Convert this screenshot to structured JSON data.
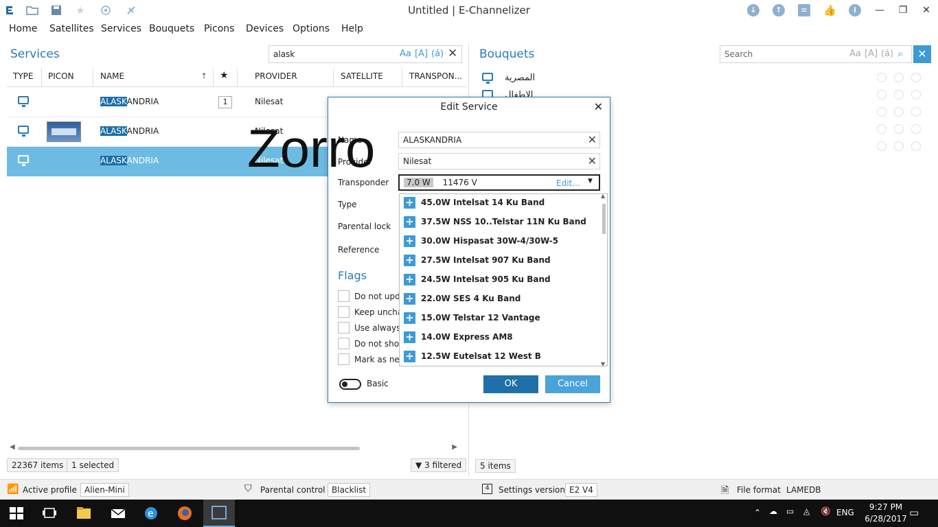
{
  "window": {
    "title": "Untitled | E-Channelizer"
  },
  "menu": [
    "Home",
    "Satellites",
    "Services",
    "Bouquets",
    "Picons",
    "Devices",
    "Options",
    "Help"
  ],
  "services": {
    "title": "Services",
    "search_value": "alask",
    "search_options": {
      "case": "Aa",
      "word": "[A]",
      "accent": "(á)"
    },
    "columns": {
      "type": "TYPE",
      "picon": "PICON",
      "name": "NAME",
      "fav_icon": "star-icon",
      "provider": "PROVIDER",
      "satellite": "SATELLITE",
      "transponder": "TRANSPON..."
    },
    "rows": [
      {
        "name_match": "ALASK",
        "name_rest": "ANDRIA",
        "badge": "1",
        "provider": "Nilesat",
        "has_picon": false,
        "selected": false
      },
      {
        "name_match": "ALASK",
        "name_rest": "ANDRIA",
        "badge": "",
        "provider": "Nilesat",
        "has_picon": true,
        "selected": false
      },
      {
        "name_match": "ALASK",
        "name_rest": "ANDRIA",
        "badge": "",
        "provider": "Nilesat",
        "has_picon": false,
        "selected": true
      }
    ],
    "status": {
      "items": "22367 items",
      "selected": "1 selected",
      "filtered": "3 filtered"
    }
  },
  "watermark": "Zorro",
  "dialog": {
    "title": "Edit Service",
    "labels": {
      "name": "Name",
      "provider": "Provider",
      "transponder": "Transponder",
      "type": "Type",
      "parental": "Parental lock",
      "reference": "Reference"
    },
    "name_value": "ALASKANDRIA",
    "provider_value": "Nilesat",
    "transponder": {
      "position": "7.0 W",
      "frequency": "11476 V",
      "edit_link": "Edit..."
    },
    "dropdown_items": [
      "45.0W Intelsat 14 Ku Band",
      "37.5W NSS 10..Telstar 11N Ku Band",
      "30.0W Hispasat 30W-4/30W-5",
      "27.5W Intelsat 907 Ku Band",
      "24.5W Intelsat 905 Ku Band",
      "22.0W SES 4 Ku Band",
      "15.0W Telstar 12 Vantage",
      "14.0W Express AM8",
      "12.5W Eutelsat 12 West B"
    ],
    "flags_title": "Flags",
    "flags": [
      "Do not upda",
      "Keep unchan",
      "Use always t",
      "Do not show",
      "Mark as new"
    ],
    "mode_label": "Basic",
    "ok_label": "OK",
    "cancel_label": "Cancel"
  },
  "bouquets": {
    "title": "Bouquets",
    "search_placeholder": "Search",
    "search_options": {
      "case": "Aa",
      "word": "[A]",
      "accent": "(á)"
    },
    "items": [
      "المصرية",
      "الاطفال"
    ],
    "status": "5 items"
  },
  "profile_bar": {
    "active_profile_label": "Active profile",
    "active_profile_value": "Alien-Mini",
    "parental_label": "Parental control",
    "parental_value": "Blacklist",
    "settings_label": "Settings version",
    "settings_value": "E2 V4",
    "file_format_label": "File format",
    "file_format_value": "LAMEDB"
  },
  "taskbar": {
    "lang": "ENG",
    "time": "9:27 PM",
    "date": "6/28/2017"
  }
}
